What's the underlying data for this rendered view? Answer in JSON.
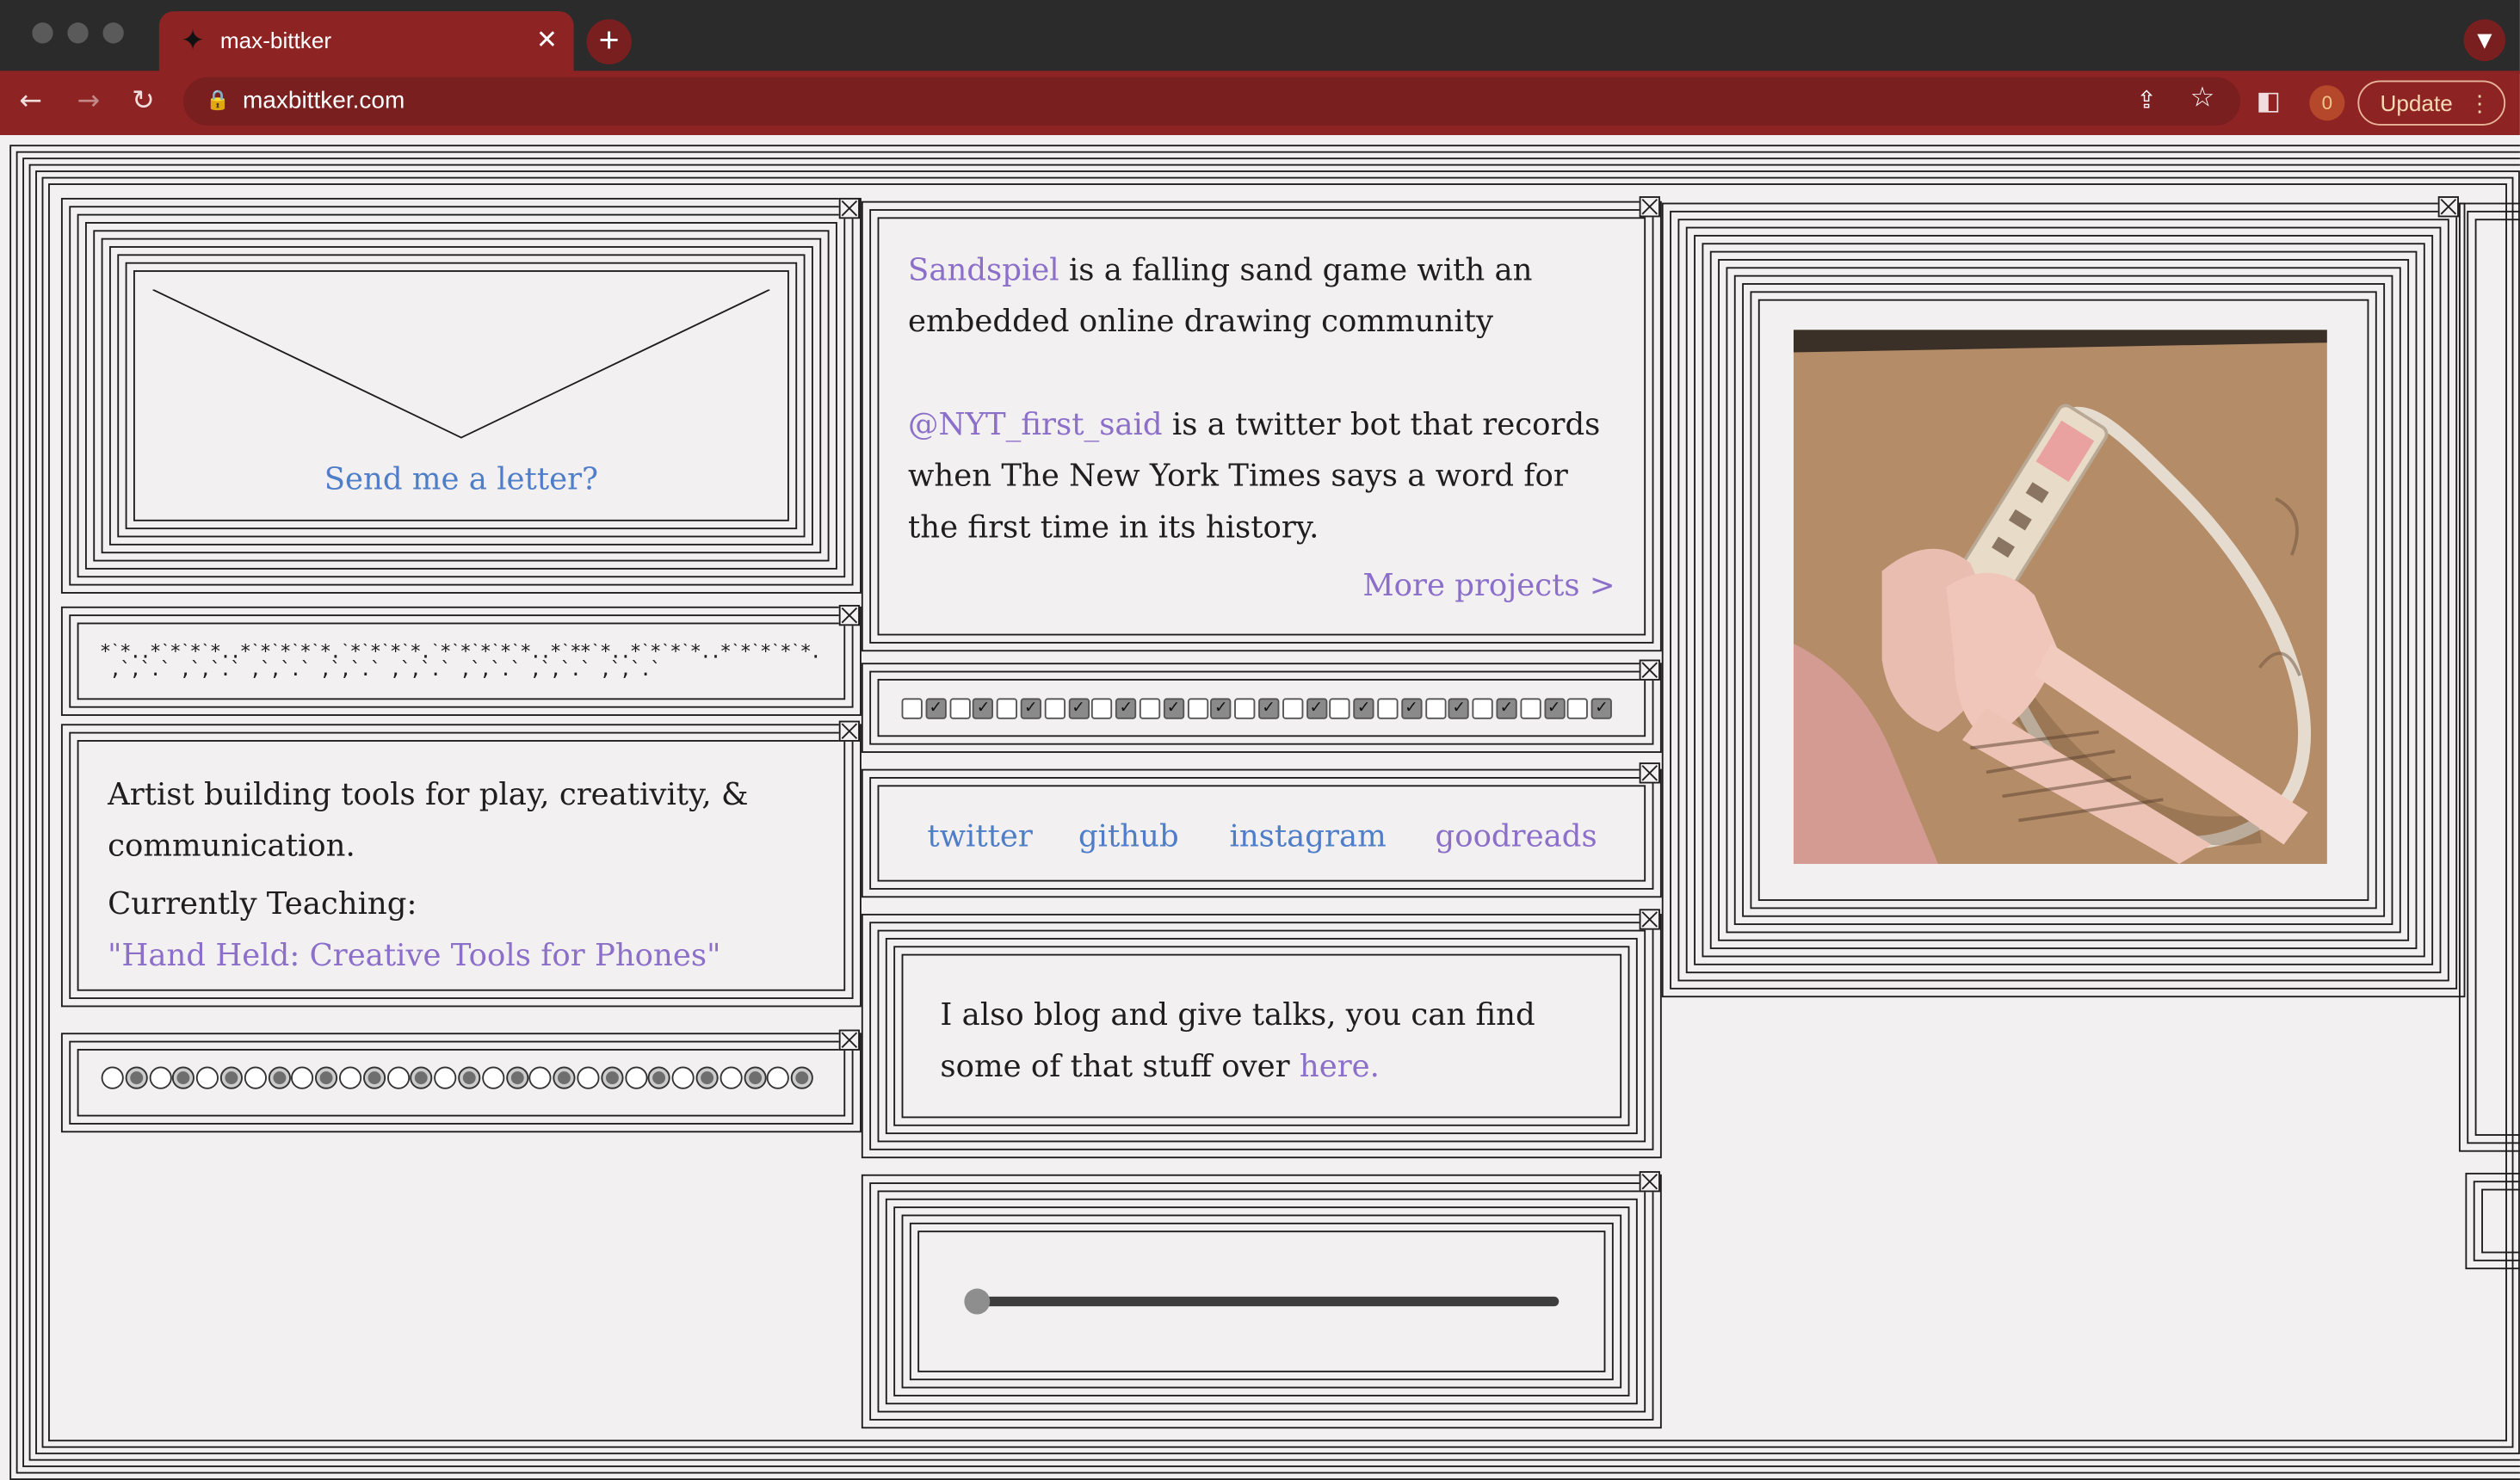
{
  "browser": {
    "tab_title": "max-bittker",
    "url": "maxbittker.com",
    "extensions_badge": "0",
    "update_label": "Update"
  },
  "letter": {
    "label": "Send me a letter?"
  },
  "projects": {
    "sandspiel_link": "Sandspiel",
    "sandspiel_text": " is a falling sand game with an embedded online drawing community",
    "nyt_link": "@NYT_first_said",
    "nyt_text": " is a twitter bot that records when The New York Times says a word for the first time in its history.",
    "more_link": "More projects >"
  },
  "about": {
    "bio": "Artist building tools for play, creativity, & communication.",
    "teaching_label": "Currently Teaching:",
    "course_link": "\"Hand Held: Creative Tools for Phones\""
  },
  "social": {
    "links": [
      "twitter",
      "github",
      "instagram",
      "goodreads"
    ]
  },
  "blog": {
    "text": "I also blog and give talks, you can find some of that stuff over ",
    "link": "here."
  },
  "checkboxes": {
    "states": [
      false,
      true,
      false,
      true,
      false,
      true,
      false,
      true,
      false,
      true,
      false,
      true,
      false,
      true,
      false,
      true,
      false,
      true,
      false,
      true,
      false,
      true,
      false,
      true,
      false,
      true,
      false,
      true,
      false,
      true,
      false,
      true,
      false,
      true,
      false,
      true,
      false,
      true,
      false,
      true,
      false,
      true,
      false,
      true,
      false,
      true,
      false,
      true
    ]
  },
  "radios": {
    "states": [
      false,
      true,
      false,
      true,
      false,
      true,
      false,
      true,
      false,
      true,
      false,
      true,
      false,
      true,
      false,
      true,
      false,
      true,
      false,
      true,
      false,
      true,
      false,
      true,
      false,
      true,
      false,
      true,
      false,
      true,
      false,
      true,
      false,
      true,
      false,
      true,
      false,
      true,
      false,
      true,
      false,
      true,
      false,
      true,
      false,
      true,
      false,
      true
    ]
  },
  "slider": {
    "value": 0
  },
  "colors": {
    "purple_link": "#8b6fc9",
    "blue_link": "#4f7ec8",
    "chrome_red": "#8e2323"
  }
}
